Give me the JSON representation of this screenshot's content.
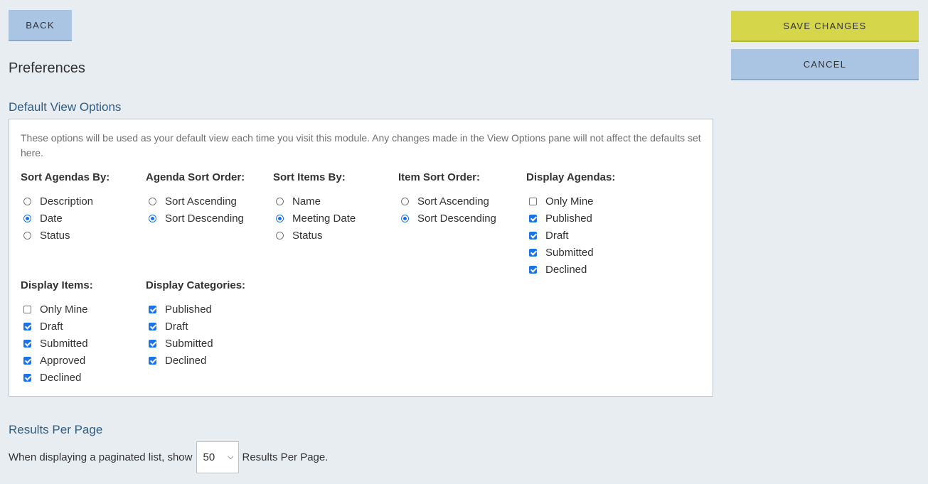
{
  "header": {
    "back_label": "BACK",
    "save_label": "SAVE CHANGES",
    "cancel_label": "CANCEL",
    "page_title": "Preferences"
  },
  "default_view": {
    "title": "Default View Options",
    "description": "These options will be used as your default view each time you visit this module. Any changes made in the View Options pane will not affect the defaults set here.",
    "groups": [
      {
        "label": "Sort Agendas By:",
        "type": "radio",
        "options": [
          {
            "label": "Description",
            "checked": false
          },
          {
            "label": "Date",
            "checked": true
          },
          {
            "label": "Status",
            "checked": false
          }
        ]
      },
      {
        "label": "Agenda Sort Order:",
        "type": "radio",
        "options": [
          {
            "label": "Sort Ascending",
            "checked": false
          },
          {
            "label": "Sort Descending",
            "checked": true
          }
        ]
      },
      {
        "label": "Sort Items By:",
        "type": "radio",
        "options": [
          {
            "label": "Name",
            "checked": false
          },
          {
            "label": "Meeting Date",
            "checked": true
          },
          {
            "label": "Status",
            "checked": false
          }
        ]
      },
      {
        "label": "Item Sort Order:",
        "type": "radio",
        "options": [
          {
            "label": "Sort Ascending",
            "checked": false
          },
          {
            "label": "Sort Descending",
            "checked": true
          }
        ]
      },
      {
        "label": "Display Agendas:",
        "type": "checkbox",
        "options": [
          {
            "label": "Only Mine",
            "checked": false
          },
          {
            "label": "Published",
            "checked": true
          },
          {
            "label": "Draft",
            "checked": true
          },
          {
            "label": "Submitted",
            "checked": true
          },
          {
            "label": "Declined",
            "checked": true
          }
        ]
      },
      {
        "label": "Display Items:",
        "type": "checkbox",
        "options": [
          {
            "label": "Only Mine",
            "checked": false
          },
          {
            "label": "Draft",
            "checked": true
          },
          {
            "label": "Submitted",
            "checked": true
          },
          {
            "label": "Approved",
            "checked": true
          },
          {
            "label": "Declined",
            "checked": true
          }
        ]
      },
      {
        "label": "Display Categories:",
        "type": "checkbox",
        "options": [
          {
            "label": "Published",
            "checked": true
          },
          {
            "label": "Draft",
            "checked": true
          },
          {
            "label": "Submitted",
            "checked": true
          },
          {
            "label": "Declined",
            "checked": true
          }
        ]
      }
    ]
  },
  "results_per_page": {
    "title": "Results Per Page",
    "prefix": "When displaying a paginated list, show",
    "selected": "50",
    "suffix": "Results Per Page."
  }
}
